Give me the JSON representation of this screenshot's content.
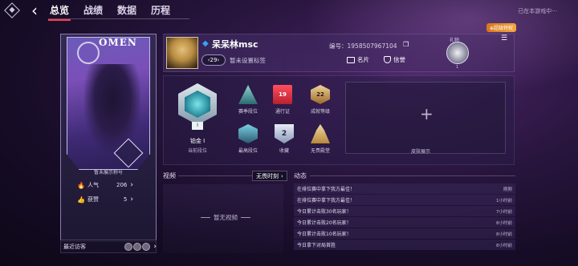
{
  "topbar": {
    "tabs": [
      {
        "label": "总览"
      },
      {
        "label": "战绩"
      },
      {
        "label": "数据"
      },
      {
        "label": "历程"
      }
    ],
    "status": "已在本游戏中···"
  },
  "hero": {
    "logo": "OMEN",
    "caption": "暂未展示称号",
    "popularity_label": "人气",
    "popularity_value": "206",
    "likes_label": "获赞",
    "likes_value": "5",
    "visitors_label": "最近访客"
  },
  "profile": {
    "nickname": "呆呆林msc",
    "level": "29",
    "tag": "暂未设置标签",
    "uid": "编号：1958507967104",
    "namecard_label": "名片",
    "credit_label": "信誉",
    "gift_label": "礼物",
    "gift_count": "1",
    "privilege_badge": "⊕超级特权"
  },
  "rank": {
    "main_tier_num": "I",
    "main_name": "铂金 I",
    "main_sub": "当前段位",
    "items": [
      {
        "label": "赛季段位",
        "icon": "season-rank-icon"
      },
      {
        "label": "通行证",
        "value": "19",
        "icon": "pass-ticket-icon"
      },
      {
        "label": "成就等级",
        "value": "22",
        "icon": "achievement-icon"
      },
      {
        "label": "最高段位",
        "icon": "highest-rank-icon"
      },
      {
        "label": "收藏",
        "value": "2",
        "icon": "collection-icon"
      },
      {
        "label": "无畏殿堂",
        "icon": "hall-icon"
      }
    ],
    "skin_label": "皮肤展示"
  },
  "video": {
    "title": "视频",
    "mode": "无畏时刻",
    "empty": "暂无视频"
  },
  "activity": {
    "title": "动态",
    "items": [
      {
        "text": "在排位赛中拿下我方最佳！",
        "time": "刚刚"
      },
      {
        "text": "在排位赛中拿下我方最佳！",
        "time": "1小时前"
      },
      {
        "text": "今日累计击败30名玩家！",
        "time": "7小时前"
      },
      {
        "text": "今日累计击败20名玩家！",
        "time": "8小时前"
      },
      {
        "text": "今日累计击败10名玩家！",
        "time": "8小时前"
      },
      {
        "text": "今日拿下对局首胜",
        "time": "8小时前"
      }
    ]
  }
}
